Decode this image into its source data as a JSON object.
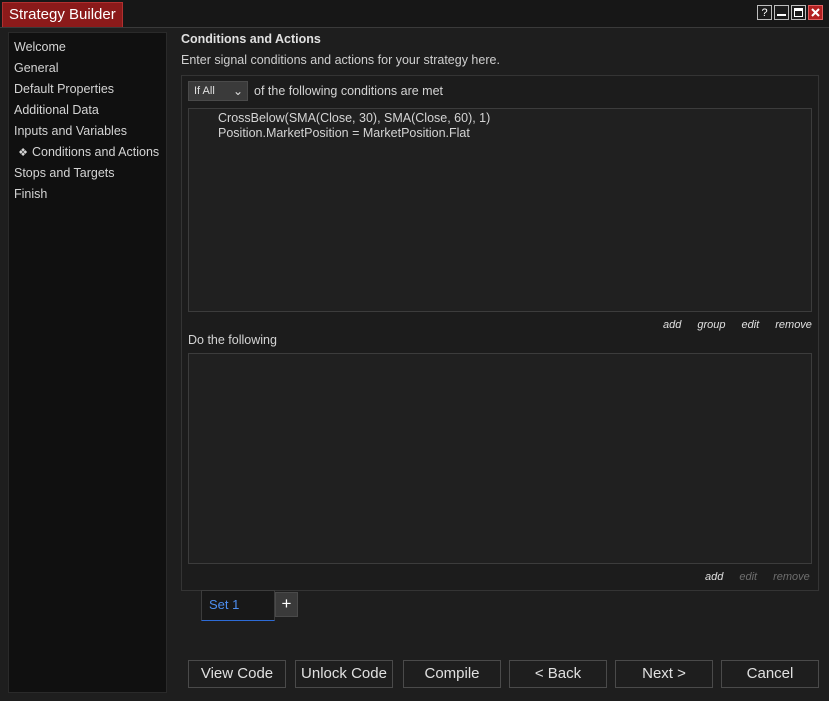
{
  "window": {
    "title": "Strategy Builder",
    "buttons": {
      "help": "?"
    }
  },
  "sidebar": {
    "items": [
      {
        "label": "Welcome",
        "active": false
      },
      {
        "label": "General",
        "active": false
      },
      {
        "label": "Default Properties",
        "active": false
      },
      {
        "label": "Additional Data",
        "active": false
      },
      {
        "label": "Inputs and Variables",
        "active": false
      },
      {
        "label": "Conditions and Actions",
        "active": true,
        "bullet": "❖"
      },
      {
        "label": "Stops and Targets",
        "active": false
      },
      {
        "label": "Finish",
        "active": false
      }
    ]
  },
  "main": {
    "heading": "Conditions and Actions",
    "subheading": "Enter signal conditions and actions for your strategy here.",
    "condition_mode": {
      "selected": "If All"
    },
    "condition_suffix": "of the following conditions are met",
    "conditions": [
      "CrossBelow(SMA(Close, 30), SMA(Close, 60), 1)",
      "Position.MarketPosition = MarketPosition.Flat"
    ],
    "condition_links": {
      "add": "add",
      "group": "group",
      "edit": "edit",
      "remove": "remove"
    },
    "actions_label": "Do the following",
    "action_links": {
      "add": "add",
      "edit": "edit",
      "remove": "remove"
    },
    "set_tab": "Set 1",
    "add_set": "+"
  },
  "footer": {
    "view_code": "View Code",
    "unlock_code": "Unlock Code",
    "compile": "Compile",
    "back": "< Back",
    "next": "Next >",
    "cancel": "Cancel"
  },
  "colors": {
    "title_accent": "#8b1a1a",
    "active_tab": "#4d8ef0"
  }
}
